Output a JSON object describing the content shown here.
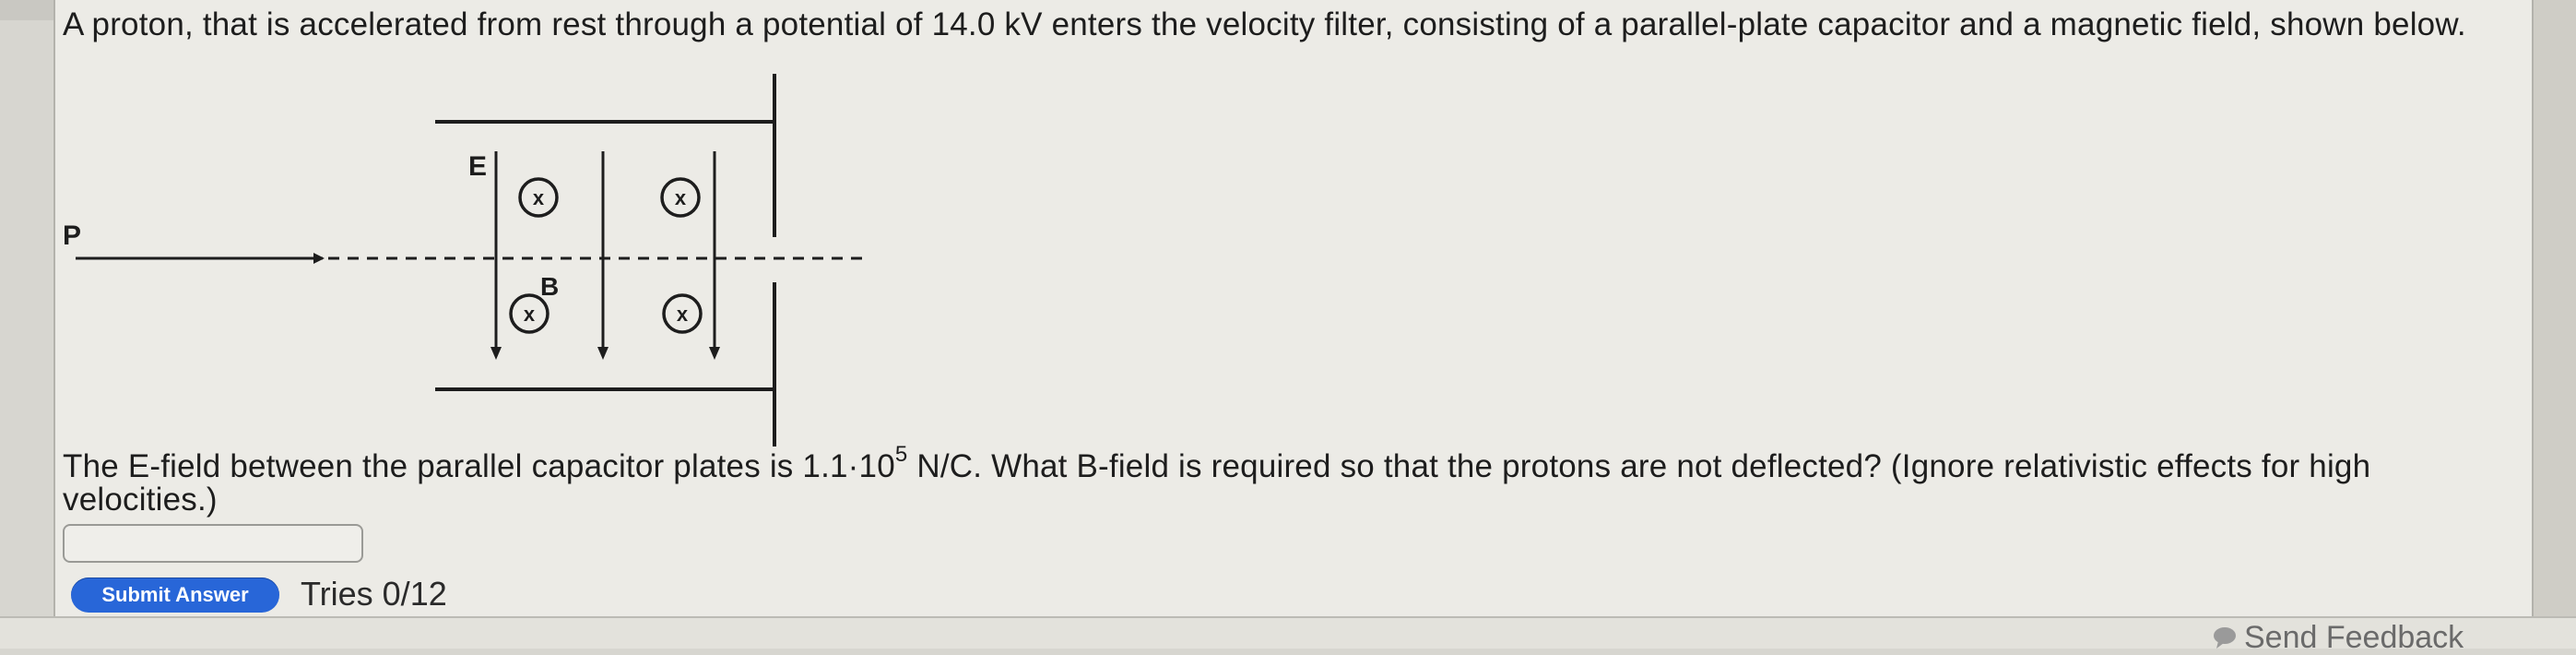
{
  "question": {
    "intro": "A proton, that is accelerated from rest through a potential of 14.0 kV enters the velocity filter, consisting of a parallel-plate capacitor and a magnetic field, shown below.",
    "prompt_part1": "The E-field between the parallel capacitor plates is 1.1·10",
    "prompt_exponent": "5",
    "prompt_part2": " N/C. What B-field is required so that the protons are not deflected? (Ignore relativistic effects for high velocities.)"
  },
  "diagram": {
    "label_p": "P",
    "label_e": "E",
    "label_b": "B",
    "field_symbol": "x"
  },
  "answer": {
    "value": "",
    "placeholder": ""
  },
  "controls": {
    "submit_label": "Submit Answer",
    "tries_text": "Tries 0/12"
  },
  "footer": {
    "feedback_label": "Send Feedback",
    "feedback_icon": "feedback-speech-icon"
  },
  "colors": {
    "submit_bg": "#2866d8",
    "panel_bg": "#ecebe6",
    "page_bg": "#d7d6d0"
  }
}
